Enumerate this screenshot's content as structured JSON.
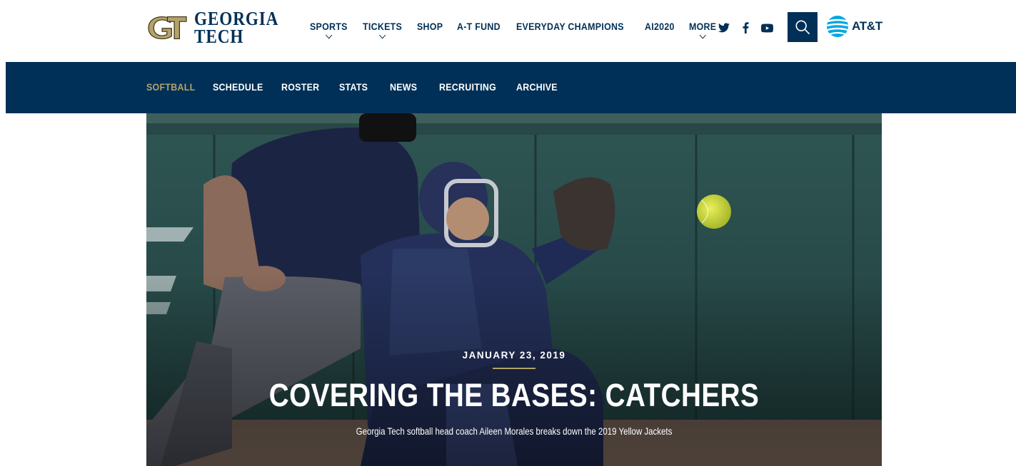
{
  "header": {
    "logo_line1": "GEORGIA",
    "logo_line2": "TECH",
    "logo_mark": "GT",
    "brand_navy": "#003057",
    "brand_gold": "#b3a369",
    "nav": [
      {
        "label": "SPORTS",
        "dropdown": true
      },
      {
        "label": "TICKETS",
        "dropdown": true
      },
      {
        "label": "SHOP",
        "dropdown": false
      },
      {
        "label": "A-T FUND",
        "dropdown": false
      },
      {
        "label": "EVERYDAY CHAMPIONS",
        "dropdown": false
      },
      {
        "label": "AI2020",
        "dropdown": false
      },
      {
        "label": "MORE",
        "dropdown": true
      }
    ],
    "social": [
      "twitter-icon",
      "facebook-icon",
      "youtube-icon"
    ],
    "search_icon": "search-icon",
    "sponsor": "AT&T"
  },
  "subnav": {
    "items": [
      {
        "label": "SOFTBALL",
        "active": true
      },
      {
        "label": "SCHEDULE",
        "active": false
      },
      {
        "label": "ROSTER",
        "active": false
      },
      {
        "label": "STATS",
        "active": false
      },
      {
        "label": "NEWS",
        "active": false
      },
      {
        "label": "RECRUITING",
        "active": false
      },
      {
        "label": "ARCHIVE",
        "active": false
      }
    ]
  },
  "hero": {
    "date": "JANUARY 23, 2019",
    "title": "COVERING THE BASES: CATCHERS",
    "subtitle": "Georgia Tech softball head coach Aileen Morales breaks down the 2019 Yellow Jackets",
    "image_description_icon": "hero-photo"
  }
}
